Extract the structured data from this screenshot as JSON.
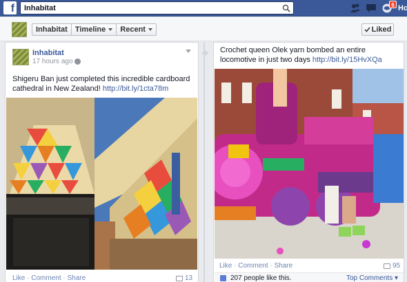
{
  "topbar": {
    "logo": "f",
    "search_value": "Inhabitat",
    "notification_count": "6",
    "home_label": "Ho"
  },
  "page_header": {
    "tabs": [
      "Inhabitat",
      "Timeline",
      "Recent"
    ],
    "liked_label": "Liked"
  },
  "left_post": {
    "author": "Inhabitat",
    "time": "17 hours ago",
    "text": "Shigeru Ban just completed this incredible cardboard cathedral in New Zealand!",
    "link": "http://bit.ly/1cta78m",
    "actions": [
      "Like",
      "Comment",
      "Share"
    ],
    "comment_count": "13"
  },
  "right_post": {
    "text": "Crochet queen Olek yarn bombed an entire locomotive in just two days",
    "link": "http://bit.ly/15HvXQa",
    "actions": [
      "Like",
      "Comment",
      "Share"
    ],
    "comment_count": "95",
    "likes": "207 people like this.",
    "top_comments": "Top Comments"
  },
  "colors": {
    "brand": "#3b5998",
    "link": "#3b5998",
    "badge": "#f03d25"
  },
  "icons": [
    "facebook-logo",
    "search-icon",
    "friends-icon",
    "messages-icon",
    "notifications-icon",
    "globe-icon",
    "chevron-down-icon",
    "comment-icon",
    "like-thumb-icon"
  ]
}
